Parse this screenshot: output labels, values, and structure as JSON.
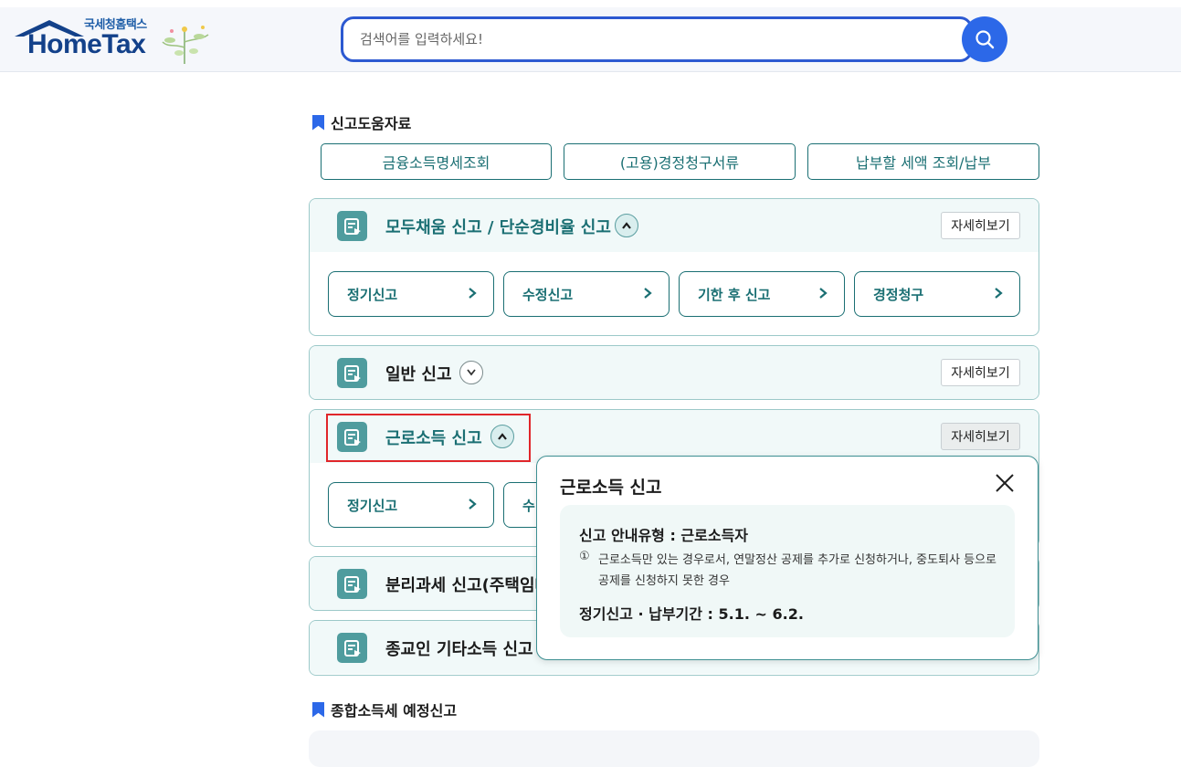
{
  "header": {
    "logo_subtitle": "국세청홈택스",
    "logo_title": "HomeTax",
    "search_placeholder": "검색어를 입력하세요!"
  },
  "sections": {
    "help_title": "신고도움자료",
    "quick_buttons": [
      "금융소득명세조회",
      "(고용)경정청구서류",
      "납부할 세액 조회/납부"
    ],
    "estimate_title": "종합소득세 예정신고"
  },
  "panels": [
    {
      "title": "모두채움 신고 / 단순경비율 신고",
      "detail": "자세히보기",
      "expanded": true,
      "buttons": [
        "정기신고",
        "수정신고",
        "기한 후 신고",
        "경정청구"
      ]
    },
    {
      "title": "일반 신고",
      "detail": "자세히보기",
      "expanded": false
    },
    {
      "title": "근로소득 신고",
      "detail": "자세히보기",
      "expanded": true,
      "buttons": [
        "정기신고",
        "수"
      ]
    },
    {
      "title": "분리과세 신고(주택임대",
      "expanded": false
    },
    {
      "title": "종교인 기타소득 신고",
      "expanded": false
    }
  ],
  "popup": {
    "title": "근로소득 신고",
    "guide_heading": "신고 안내유형 : 근로소득자",
    "item_marker": "①",
    "item_text": "근로소득만 있는 경우로서, 연말정산 공제를 추가로 신청하거나, 중도퇴사 등으로 공제를 신청하지 못한 경우",
    "period": "정기신고 · 납부기간 : 5.1. ~ 6.2."
  },
  "colors": {
    "accent": "#2c68e8",
    "teal": "#1a6f73",
    "highlight": "#e0262a"
  }
}
